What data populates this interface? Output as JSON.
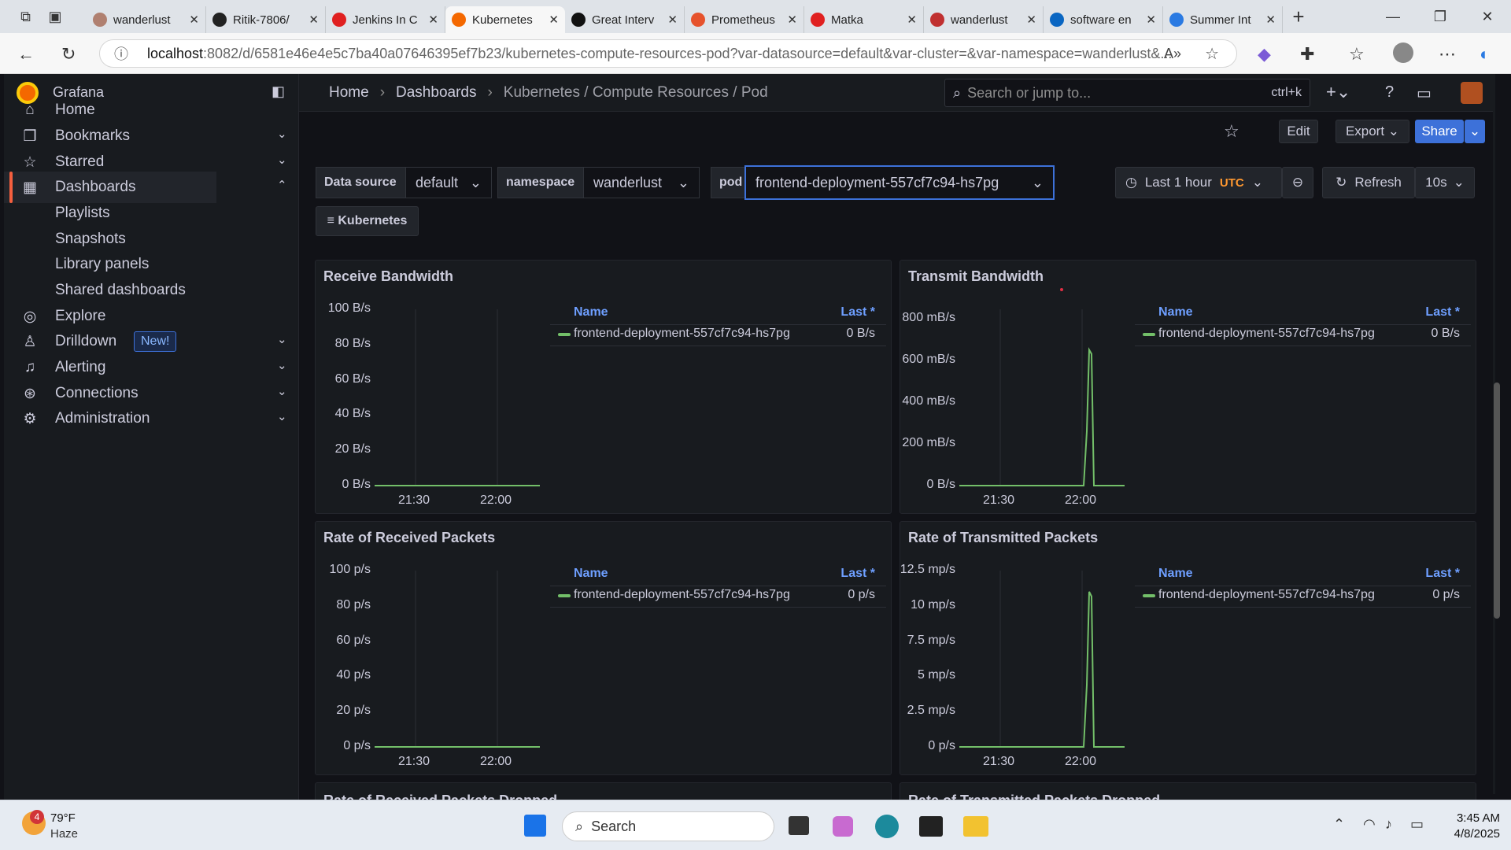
{
  "browser": {
    "tabs": [
      {
        "label": "wanderlust",
        "color": "#b08070"
      },
      {
        "label": "Ritik-7806/",
        "color": "#222"
      },
      {
        "label": "Jenkins In C",
        "color": "#e02020"
      },
      {
        "label": "Kubernetes",
        "color": "#f46800"
      },
      {
        "label": "Great Interv",
        "color": "#111"
      },
      {
        "label": "Prometheus",
        "color": "#e6522c"
      },
      {
        "label": "Matka",
        "color": "#e02020"
      },
      {
        "label": "wanderlust",
        "color": "#c03030"
      },
      {
        "label": "software en",
        "color": "#0a66c2"
      },
      {
        "label": "Summer Int",
        "color": "#2a7ae2"
      }
    ],
    "url_host": "localhost",
    "url_rest": ":8082/d/6581e46e4e5c7ba40a07646395ef7b23/kubernetes-compute-resources-pod?var-datasource=default&var-cluster=&var-namespace=wanderlust&..."
  },
  "grafana": {
    "brand": "Grafana",
    "breadcrumb": [
      "Home",
      "Dashboards",
      "Kubernetes / Compute Resources / Pod"
    ],
    "search_placeholder": "Search or jump to...",
    "search_shortcut": "ctrl+k",
    "nav": [
      {
        "label": "Home",
        "icon": "⌂"
      },
      {
        "label": "Bookmarks",
        "icon": "❒",
        "chev": "⌄"
      },
      {
        "label": "Starred",
        "icon": "☆",
        "chev": "⌄"
      },
      {
        "label": "Dashboards",
        "icon": "▦",
        "chev": "⌃"
      },
      {
        "label": "Playlists"
      },
      {
        "label": "Snapshots"
      },
      {
        "label": "Library panels"
      },
      {
        "label": "Shared dashboards"
      },
      {
        "label": "Explore",
        "icon": "◎"
      },
      {
        "label": "Drilldown",
        "icon": "♙",
        "chev": "⌄",
        "badge": "New!"
      },
      {
        "label": "Alerting",
        "icon": "♫",
        "chev": "⌄"
      },
      {
        "label": "Connections",
        "icon": "⊛",
        "chev": "⌄"
      },
      {
        "label": "Administration",
        "icon": "⚙",
        "chev": "⌄"
      }
    ],
    "toolbar": {
      "edit": "Edit",
      "export": "Export",
      "share": "Share"
    },
    "vars": {
      "datasource_label": "Data source",
      "datasource_value": "default",
      "namespace_label": "namespace",
      "namespace_value": "wanderlust",
      "pod_label": "pod",
      "pod_value": "frontend-deployment-557cf7c94-hs7pg",
      "kubernetes": "Kubernetes"
    },
    "time": {
      "range": "Last 1 hour",
      "tz": "UTC",
      "refresh": "Refresh",
      "interval": "10s"
    },
    "panels": [
      {
        "title": "Receive Bandwidth",
        "yticks": [
          "100 B/s",
          "80 B/s",
          "60 B/s",
          "40 B/s",
          "20 B/s",
          "0 B/s"
        ],
        "xticks": [
          "21:30",
          "22:00"
        ],
        "legend_name": "Name",
        "legend_last": "Last *",
        "series": "frontend-deployment-557cf7c94-hs7pg",
        "last": "0 B/s",
        "spike": 0
      },
      {
        "title": "Transmit Bandwidth",
        "yticks": [
          "800 mB/s",
          "600 mB/s",
          "400 mB/s",
          "200 mB/s",
          "0 B/s"
        ],
        "xticks": [
          "21:30",
          "22:00"
        ],
        "legend_name": "Name",
        "legend_last": "Last *",
        "series": "frontend-deployment-557cf7c94-hs7pg",
        "last": "0 B/s",
        "spike": 0.77
      },
      {
        "title": "Rate of Received Packets",
        "yticks": [
          "100 p/s",
          "80 p/s",
          "60 p/s",
          "40 p/s",
          "20 p/s",
          "0 p/s"
        ],
        "xticks": [
          "21:30",
          "22:00"
        ],
        "legend_name": "Name",
        "legend_last": "Last *",
        "series": "frontend-deployment-557cf7c94-hs7pg",
        "last": "0 p/s",
        "spike": 0
      },
      {
        "title": "Rate of Transmitted Packets",
        "yticks": [
          "12.5 mp/s",
          "10 mp/s",
          "7.5 mp/s",
          "5 mp/s",
          "2.5 mp/s",
          "0 p/s"
        ],
        "xticks": [
          "21:30",
          "22:00"
        ],
        "legend_name": "Name",
        "legend_last": "Last *",
        "series": "frontend-deployment-557cf7c94-hs7pg",
        "last": "0 p/s",
        "spike": 0.88
      }
    ],
    "lower_panels": [
      "Rate of Received Packets Dropped",
      "Rate of Transmitted Packets Dropped"
    ]
  },
  "taskbar": {
    "weather_badge": "4",
    "temp": "79°F",
    "condition": "Haze",
    "search": "Search",
    "time": "3:45 AM",
    "date": "4/8/2025"
  }
}
